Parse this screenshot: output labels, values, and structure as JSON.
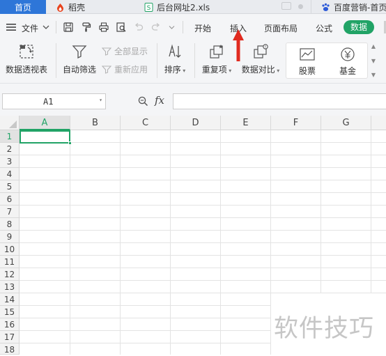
{
  "tabs": [
    {
      "label": "首页",
      "active": true
    },
    {
      "label": "稻壳",
      "icon": "docer-icon"
    },
    {
      "label": "后台网址2.xls",
      "icon": "spreadsheet-file-icon"
    },
    {
      "label": "百度营销-首页",
      "icon": "baidu-paw-icon"
    }
  ],
  "menu": {
    "file": "文件",
    "items": [
      "开始",
      "插入",
      "页面布局",
      "公式",
      "数据"
    ],
    "active": "数据"
  },
  "ribbon": {
    "pivot": "数据透视表",
    "autofilter": "自动筛选",
    "show_all": "全部显示",
    "reapply": "重新应用",
    "sort": "排序",
    "duplicates": "重复项",
    "compare": "数据对比",
    "stock": "股票",
    "fund": "基金"
  },
  "formula_bar": {
    "name_box": "A1",
    "fx": "fx",
    "value": ""
  },
  "grid": {
    "columns": [
      "A",
      "B",
      "C",
      "D",
      "E",
      "F",
      "G"
    ],
    "rows": [
      "1",
      "2",
      "3",
      "4",
      "5",
      "6",
      "7",
      "8",
      "9",
      "10",
      "11",
      "12",
      "13",
      "14",
      "15",
      "16",
      "17",
      "18"
    ],
    "selected_cell": "A1"
  },
  "watermark": "软件技巧",
  "colors": {
    "accent_green": "#21a366",
    "tab_blue": "#2e76d8",
    "arrow_red": "#e02b20"
  }
}
